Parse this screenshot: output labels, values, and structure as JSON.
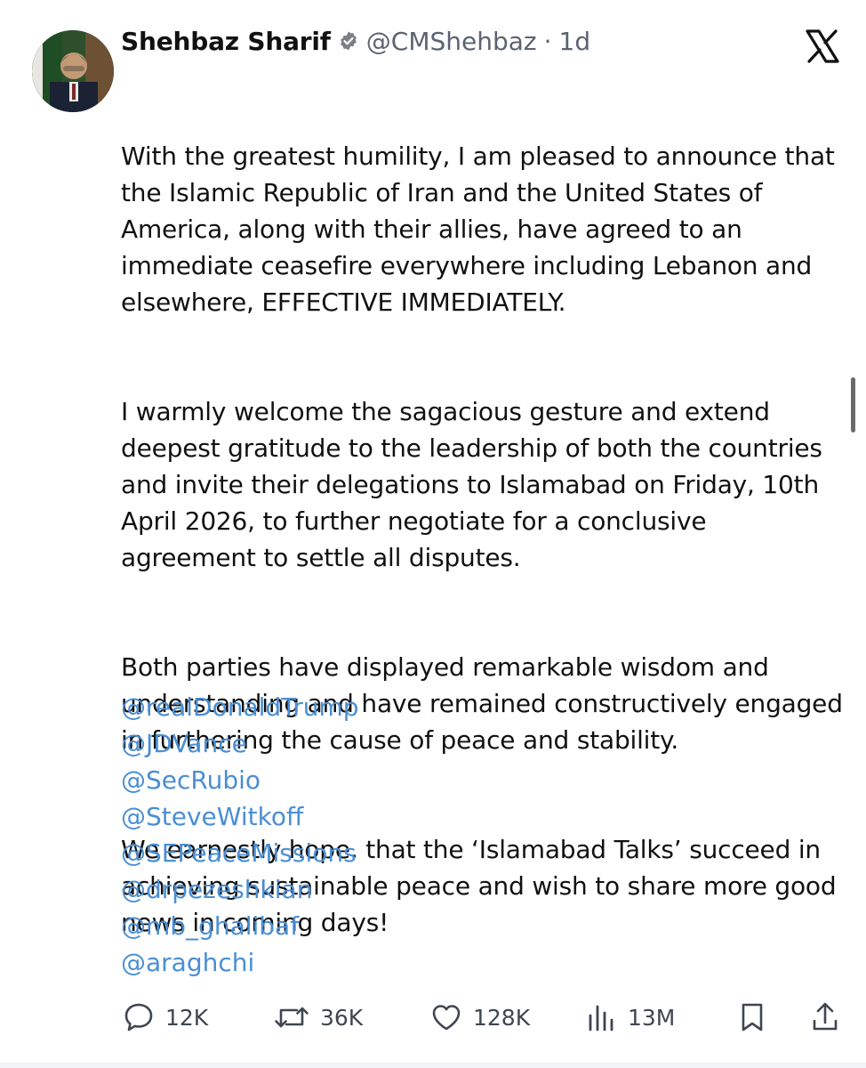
{
  "tweet": {
    "author": {
      "display_name": "Shehbaz Sharif",
      "handle": "@CMShehbaz",
      "separator": "·",
      "time": "1d",
      "verified_icon": "verified-badge-icon"
    },
    "paragraphs": [
      "With the greatest humility, I am pleased to announce that the Islamic Republic of Iran and the United States of America, along with their allies, have agreed to an immediate ceasefire everywhere including Lebanon and elsewhere, EFFECTIVE IMMEDIATELY.",
      "I warmly welcome the sagacious gesture and extend deepest gratitude to the leadership of both the countries and invite their delegations to Islamabad on Friday, 10th April 2026, to further negotiate for a conclusive agreement to settle all disputes.",
      "Both parties have displayed remarkable wisdom and understanding and have remained constructively engaged in furthering the cause of peace and stability.",
      "We earnestly hope, that the ‘Islamabad Talks’ succeed in achieving sustainable peace and wish to share more good news in coming days!"
    ],
    "mentions": [
      "@realDonaldTrump",
      "@JDVance",
      "@SecRubio",
      "@SteveWitkoff",
      "@SEPeaceMissions",
      "@drpezeshkian",
      "@mb_ghalibaf",
      "@araghchi"
    ],
    "actions": {
      "replies": "12K",
      "reposts": "36K",
      "likes": "128K",
      "views": "13M"
    }
  },
  "colors": {
    "text": "#111111",
    "muted": "#5b6470",
    "link": "#4a8fd4",
    "verified": "#7b7f86"
  },
  "icons": {
    "brand": "x-logo-icon",
    "reply": "reply-bubble-icon",
    "repost": "repost-icon",
    "like": "heart-icon",
    "views": "views-bar-chart-icon",
    "bookmark": "bookmark-icon",
    "share": "share-upload-icon"
  }
}
